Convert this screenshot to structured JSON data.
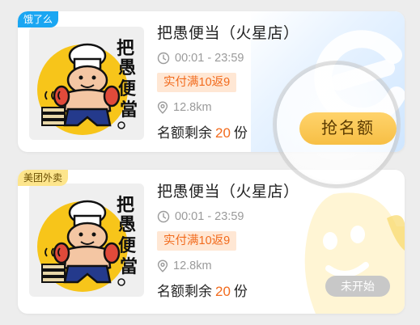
{
  "cards": [
    {
      "platform_tag": "饿了么",
      "shop_name": "把愚便当（火星店）",
      "hours": "00:01 - 23:59",
      "promo": "实付满10返9",
      "distance": "12.8km",
      "quota_prefix": "名额剩余",
      "quota_count": "20",
      "quota_unit": "份",
      "action_label": "抢名额",
      "logo_text": [
        "把",
        "愚",
        "便",
        "當"
      ]
    },
    {
      "platform_tag": "美团外卖",
      "shop_name": "把愚便当（火星店）",
      "hours": "00:01 - 23:59",
      "promo": "实付满10返9",
      "distance": "12.8km",
      "quota_prefix": "名额剩余",
      "quota_count": "20",
      "quota_unit": "份",
      "action_label": "未开始",
      "logo_text": [
        "把",
        "愚",
        "便",
        "當"
      ]
    }
  ],
  "colors": {
    "accent_orange": "#f26b1d",
    "promo_bg": "#ffe7d4",
    "grab_button": "#f7bf45",
    "disabled_button": "#c8c8c8",
    "eleme_blue": "#1aa6f2",
    "meituan_yellow": "#fde58c"
  },
  "icons": [
    "clock-icon",
    "location-pin-icon"
  ]
}
